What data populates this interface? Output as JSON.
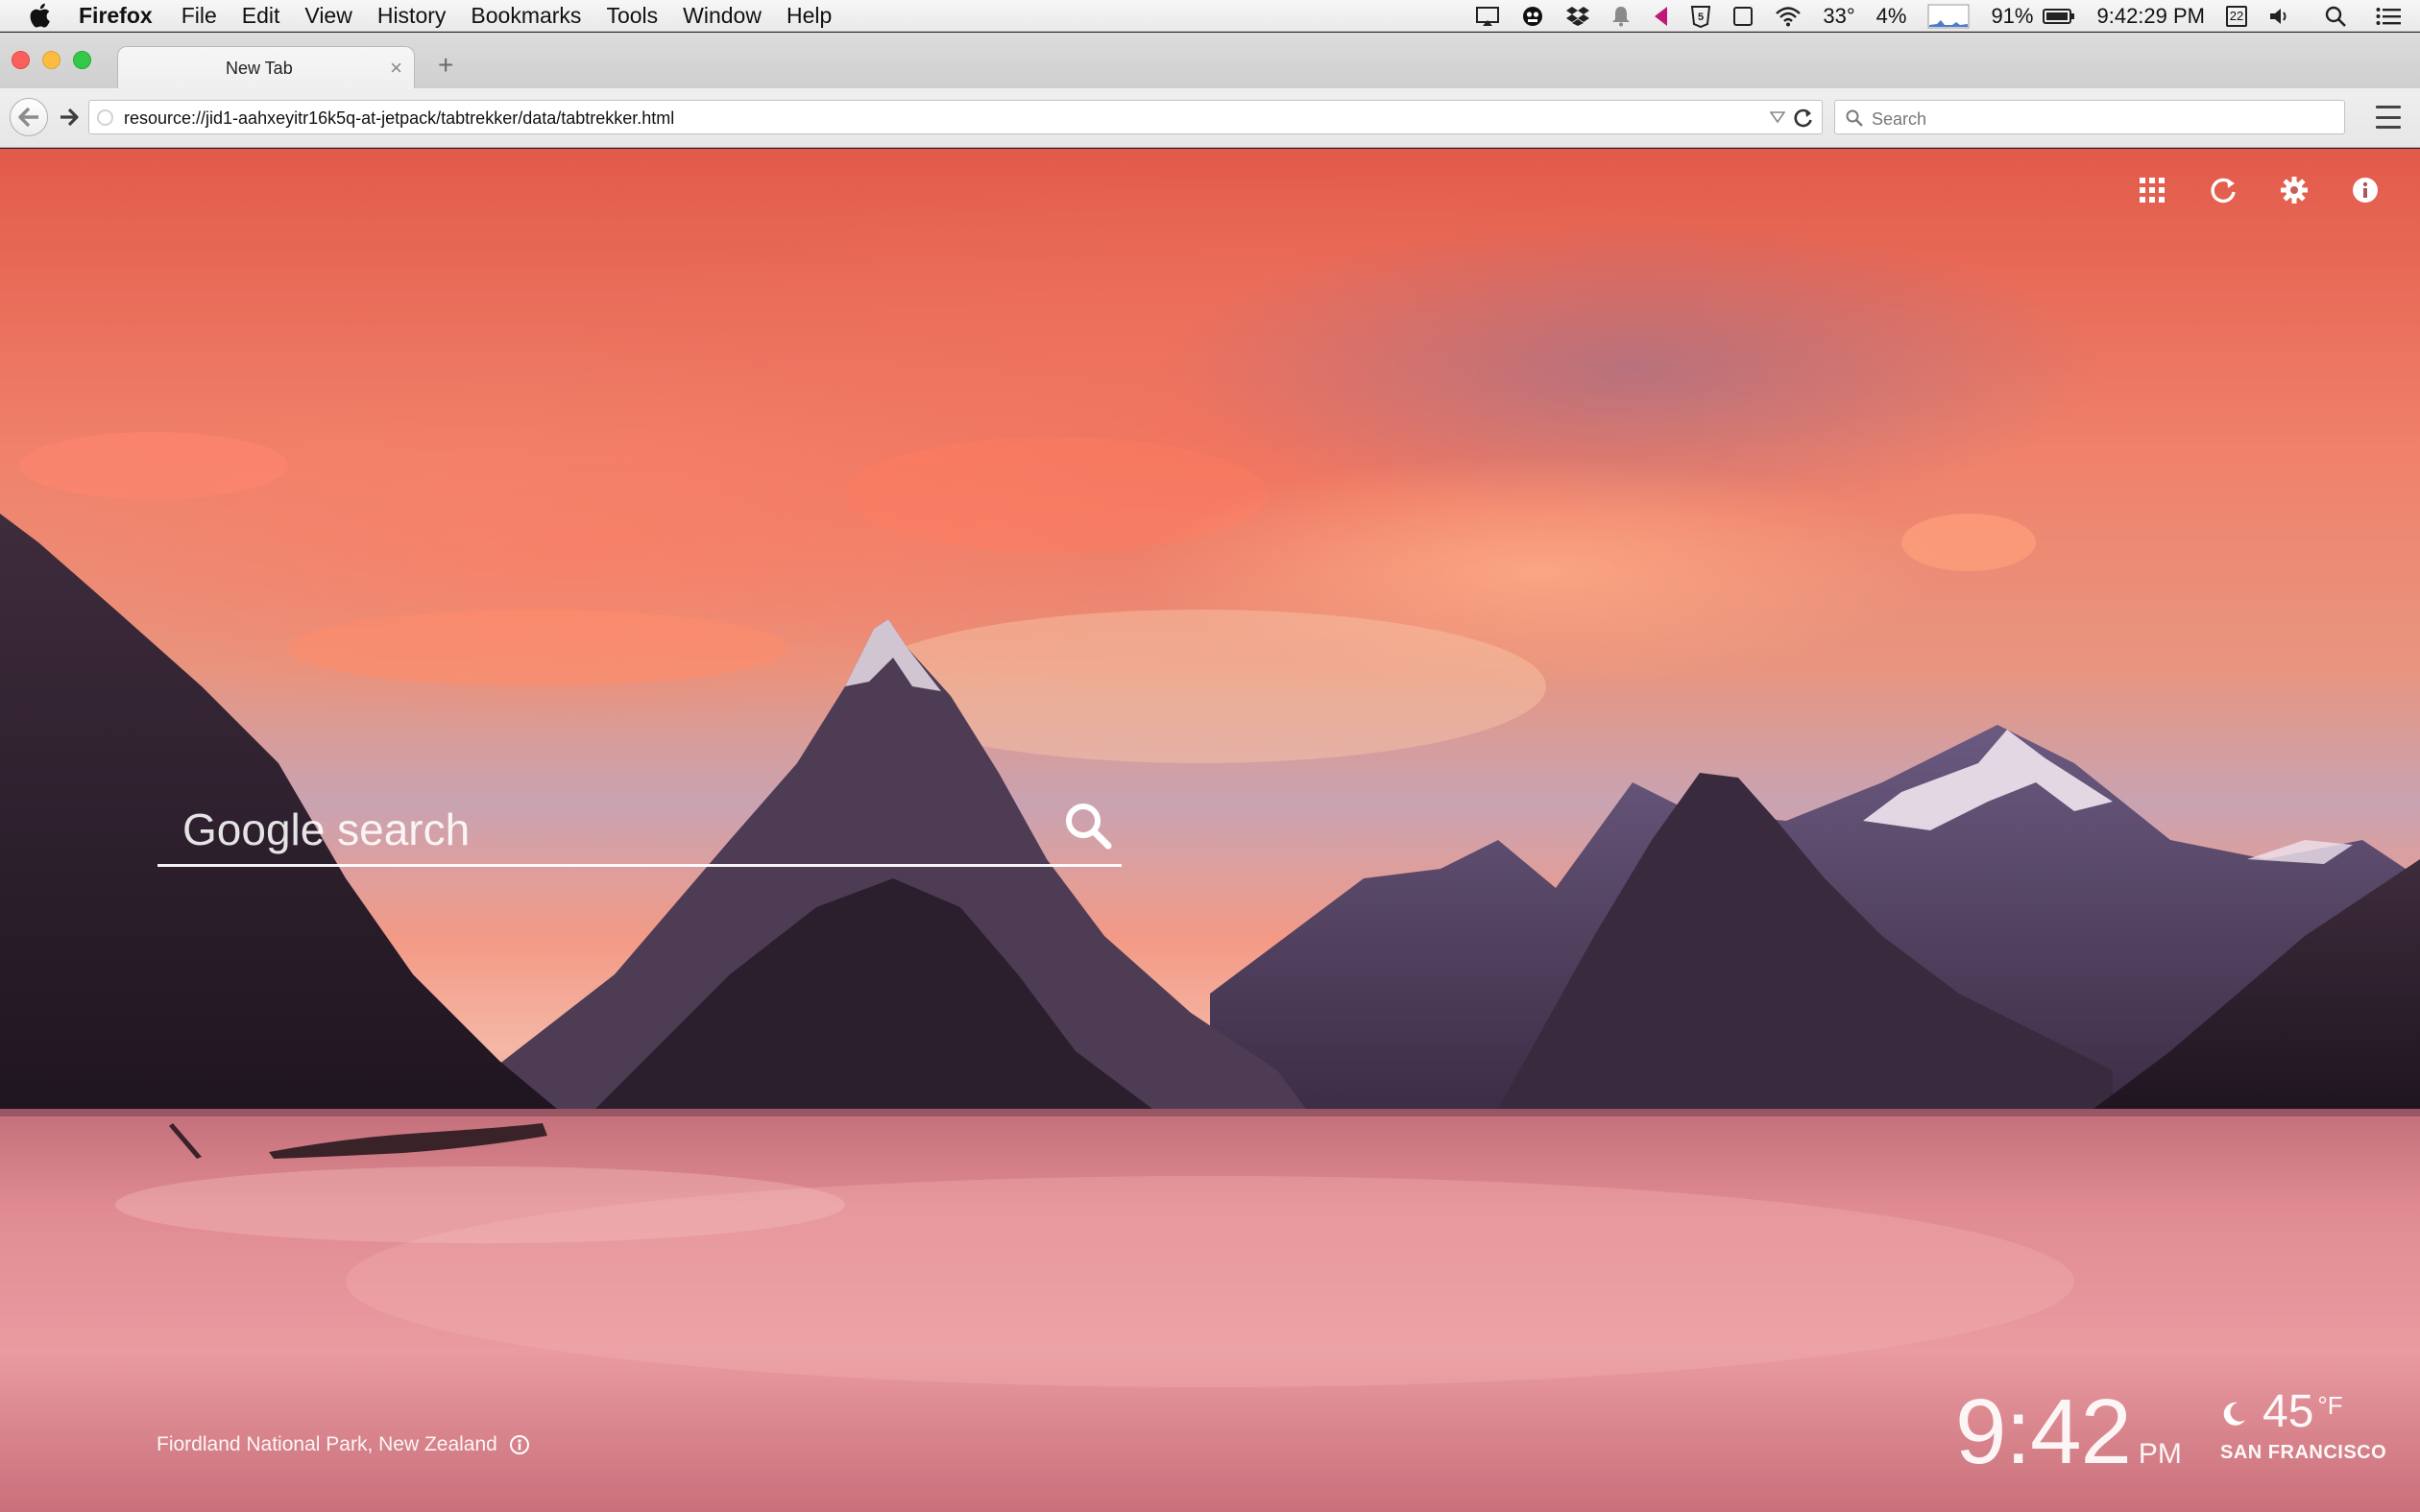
{
  "menubar": {
    "app_name": "Firefox",
    "menus": [
      "File",
      "Edit",
      "View",
      "History",
      "Bookmarks",
      "Tools",
      "Window",
      "Help"
    ],
    "status": {
      "temperature": "33°",
      "cpu": "4%",
      "battery_percent": "91%",
      "clock": "9:42:29 PM",
      "calendar_day": "22"
    }
  },
  "browser": {
    "tab_title": "New Tab",
    "tab_close": "×",
    "new_tab": "+",
    "url": "resource://jid1-aahxeyitr16k5q-at-jetpack/tabtrekker/data/tabtrekker.html",
    "search_placeholder": "Search"
  },
  "page": {
    "search_placeholder": "Google search",
    "location": "Fiordland National Park, New Zealand",
    "time": "9:42",
    "ampm": "PM",
    "temperature": "45",
    "temperature_unit": "°F",
    "city": "SAN FRANCISCO"
  },
  "colors": {
    "sky_top": "#e25a4a",
    "mountain_dark": "#2a1a26",
    "water": "#e58f96",
    "white_text": "#ffffff"
  }
}
